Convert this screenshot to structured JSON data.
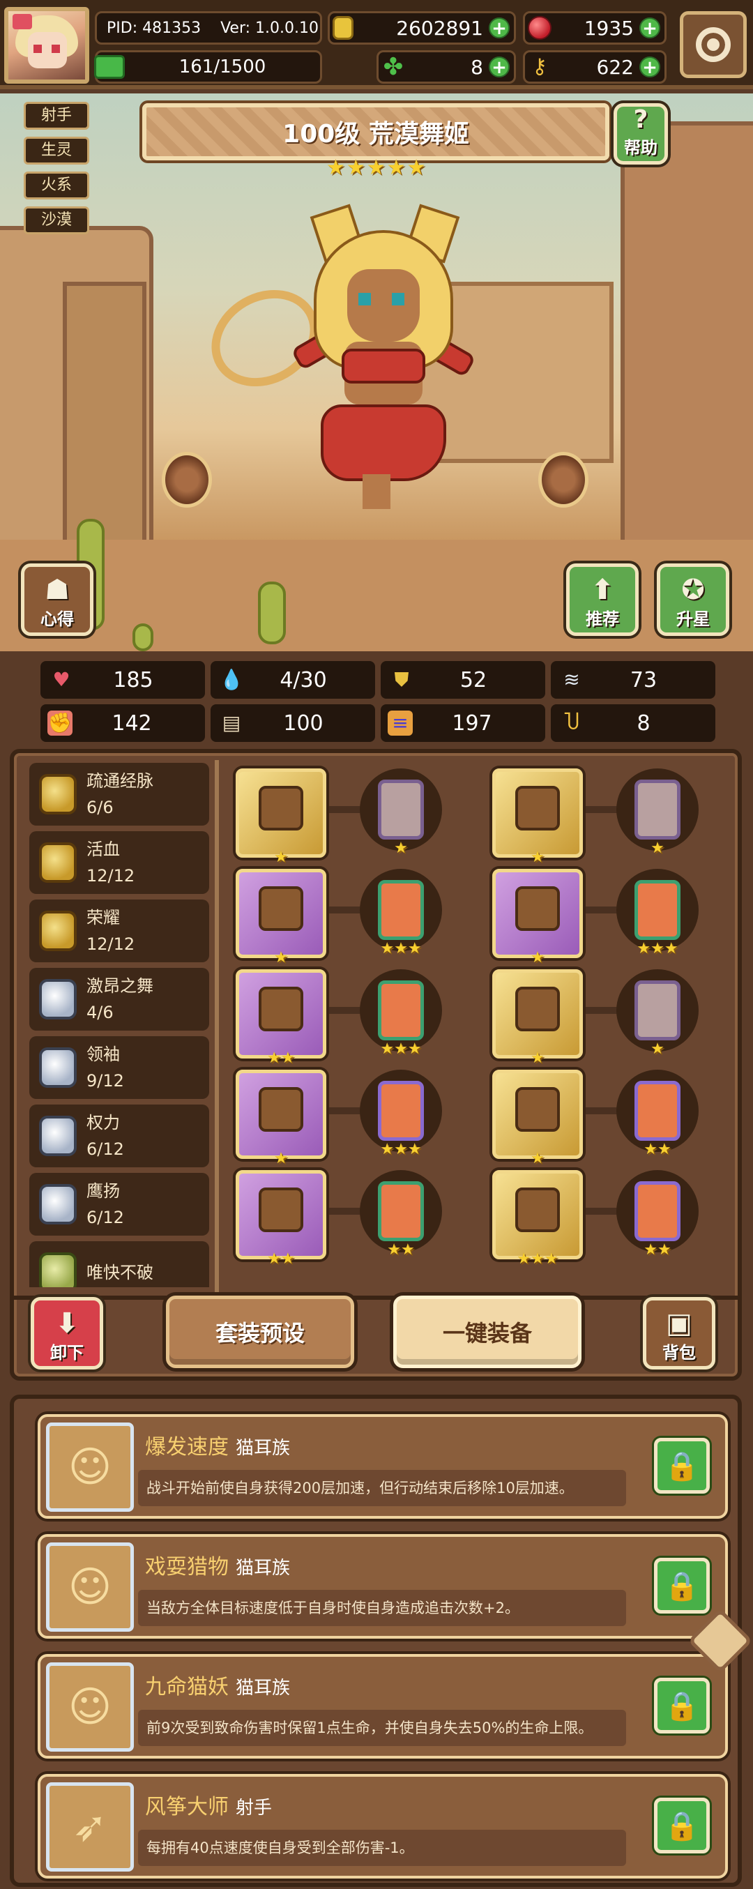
{
  "header": {
    "pid": "PID: 481353",
    "version": "Ver: 1.0.0.10",
    "gold": "2602891",
    "gems": "1935",
    "energy": "161/1500",
    "clover": "8",
    "keys": "622"
  },
  "hero": {
    "tags": [
      "射手",
      "生灵",
      "火系",
      "沙漠"
    ],
    "title": "100级  荒漠舞姬",
    "stars": 5,
    "help_label": "帮助",
    "heart_label": "心得",
    "recommend_label": "推荐",
    "starup_label": "升星"
  },
  "stats": [
    {
      "icon": "heart-icon",
      "value": "185",
      "color": "#e85a6a"
    },
    {
      "icon": "water-drop-icon",
      "value": "4/30",
      "color": "#4ab0e8"
    },
    {
      "icon": "shield-icon",
      "value": "52",
      "color": "#e8c040"
    },
    {
      "icon": "wing-icon",
      "value": "73",
      "color": "#e0e8f0"
    },
    {
      "icon": "fist-icon",
      "value": "142",
      "color": "#e87a6a"
    },
    {
      "icon": "book-icon",
      "value": "100",
      "color": "#e8d8b8"
    },
    {
      "icon": "rank-icon",
      "value": "197",
      "color": "#e8a040"
    },
    {
      "icon": "horseshoe-icon",
      "value": "8",
      "color": "#f0c040"
    }
  ],
  "sets": [
    {
      "name": "疏通经脉",
      "progress": "6/6",
      "tier": "gold"
    },
    {
      "name": "活血",
      "progress": "12/12",
      "tier": "gold"
    },
    {
      "name": "荣耀",
      "progress": "12/12",
      "tier": "gold"
    },
    {
      "name": "激昂之舞",
      "progress": "4/6",
      "tier": "silver"
    },
    {
      "name": "领袖",
      "progress": "9/12",
      "tier": "silver"
    },
    {
      "name": "权力",
      "progress": "6/12",
      "tier": "silver"
    },
    {
      "name": "鹰扬",
      "progress": "6/12",
      "tier": "silver"
    },
    {
      "name": "唯快不破",
      "progress": "",
      "tier": "green"
    }
  ],
  "equipment": [
    {
      "slot": "mace",
      "rarity": "gold",
      "stars": 1,
      "rune": "gray",
      "rune_stars": 1
    },
    {
      "slot": "helmet",
      "rarity": "gold",
      "stars": 1,
      "rune": "gray",
      "rune_stars": 1
    },
    {
      "slot": "staff",
      "rarity": "purple",
      "stars": 1,
      "rune": "orange",
      "rune_stars": 3
    },
    {
      "slot": "armor",
      "rarity": "purple",
      "stars": 1,
      "rune": "orange",
      "rune_stars": 3
    },
    {
      "slot": "necklace",
      "rarity": "purple",
      "stars": 2,
      "rune": "orange",
      "rune_stars": 3
    },
    {
      "slot": "ring",
      "rarity": "gold",
      "stars": 1,
      "rune": "gray",
      "rune_stars": 1
    },
    {
      "slot": "amulet",
      "rarity": "purple",
      "stars": 1,
      "rune": "orange2",
      "rune_stars": 3
    },
    {
      "slot": "belt",
      "rarity": "gold",
      "stars": 1,
      "rune": "orange2",
      "rune_stars": 2
    },
    {
      "slot": "bracelet",
      "rarity": "purple",
      "stars": 2,
      "rune": "orange",
      "rune_stars": 2
    },
    {
      "slot": "boots",
      "rarity": "gold",
      "stars": 3,
      "rune": "orange2",
      "rune_stars": 2
    }
  ],
  "actions": {
    "unequip": "卸下",
    "preset": "套装预设",
    "equip_all": "一键装备",
    "backpack": "背包"
  },
  "skills": [
    {
      "name": "爆发速度",
      "tribe": "猫耳族",
      "desc": "战斗开始前使自身获得200层加速，但行动结束后移除10层加速。",
      "icon": "cat-icon"
    },
    {
      "name": "戏耍猎物",
      "tribe": "猫耳族",
      "desc": "当敌方全体目标速度低于自身时使自身造成追击次数+2。",
      "icon": "cat-icon"
    },
    {
      "name": "九命猫妖",
      "tribe": "猫耳族",
      "desc": "前9次受到致命伤害时保留1点生命，并使自身失去50%的生命上限。",
      "icon": "cat-icon"
    },
    {
      "name": "风筝大师",
      "tribe": "射手",
      "desc": "每拥有40点速度使自身受到全部伤害-1。",
      "icon": "bow-icon"
    }
  ]
}
